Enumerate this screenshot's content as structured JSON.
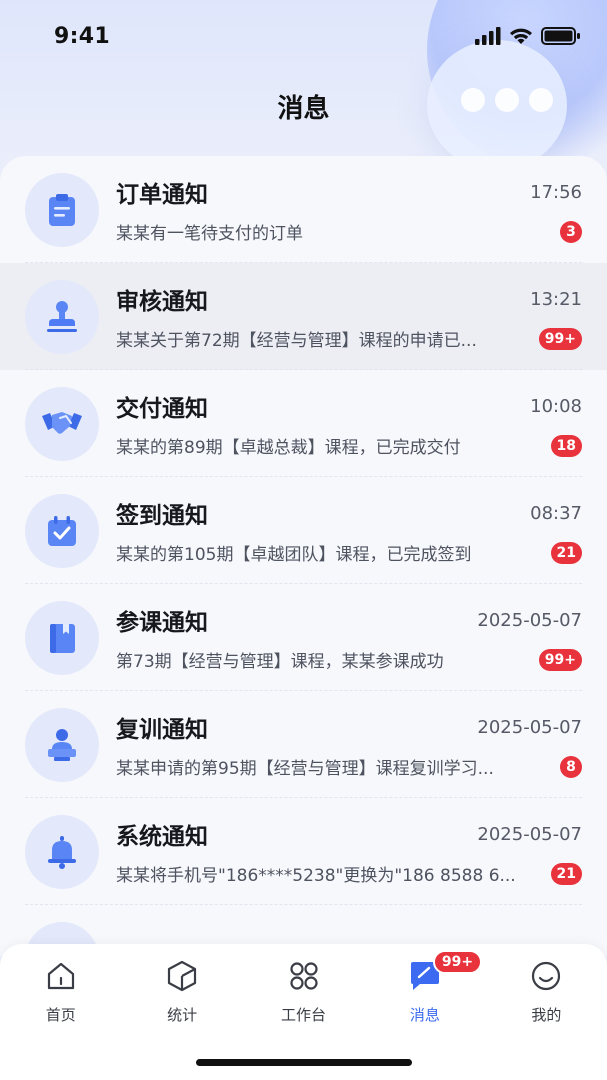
{
  "status_bar": {
    "time": "9:41"
  },
  "header": {
    "title": "消息"
  },
  "notifications": [
    {
      "title": "订单通知",
      "time": "17:56",
      "preview": "某某有一笔待支付的订单",
      "badge": "3",
      "icon": "clipboard-icon"
    },
    {
      "title": "审核通知",
      "time": "13:21",
      "preview": "某某关于第72期【经营与管理】课程的申请已...",
      "badge": "99+",
      "icon": "stamp-icon"
    },
    {
      "title": "交付通知",
      "time": "10:08",
      "preview": "某某的第89期【卓越总裁】课程，已完成交付",
      "badge": "18",
      "icon": "handshake-icon"
    },
    {
      "title": "签到通知",
      "time": "08:37",
      "preview": "某某的第105期【卓越团队】课程，已完成签到",
      "badge": "21",
      "icon": "calendar-check-icon"
    },
    {
      "title": "参课通知",
      "time": "2025-05-07",
      "preview": "第73期【经营与管理】课程，某某参课成功",
      "badge": "99+",
      "icon": "book-icon"
    },
    {
      "title": "复训通知",
      "time": "2025-05-07",
      "preview": "某某申请的第95期【经营与管理】课程复训学习...",
      "badge": "8",
      "icon": "teacher-icon"
    },
    {
      "title": "系统通知",
      "time": "2025-05-07",
      "preview": "某某将手机号\"186****5238\"更换为\"186 8588 6...",
      "badge": "21",
      "icon": "bell-icon"
    }
  ],
  "tabbar": {
    "tabs": [
      {
        "label": "首页",
        "icon": "home-icon"
      },
      {
        "label": "统计",
        "icon": "cube-icon"
      },
      {
        "label": "工作台",
        "icon": "grid-icon"
      },
      {
        "label": "消息",
        "icon": "message-icon",
        "active": true,
        "badge": "99+"
      },
      {
        "label": "我的",
        "icon": "smile-icon"
      }
    ]
  },
  "colors": {
    "accent": "#3c6af0",
    "badge": "#e8323c",
    "icon_bg": "#e3e9fb",
    "icon_fg": "#4f7cf4"
  }
}
